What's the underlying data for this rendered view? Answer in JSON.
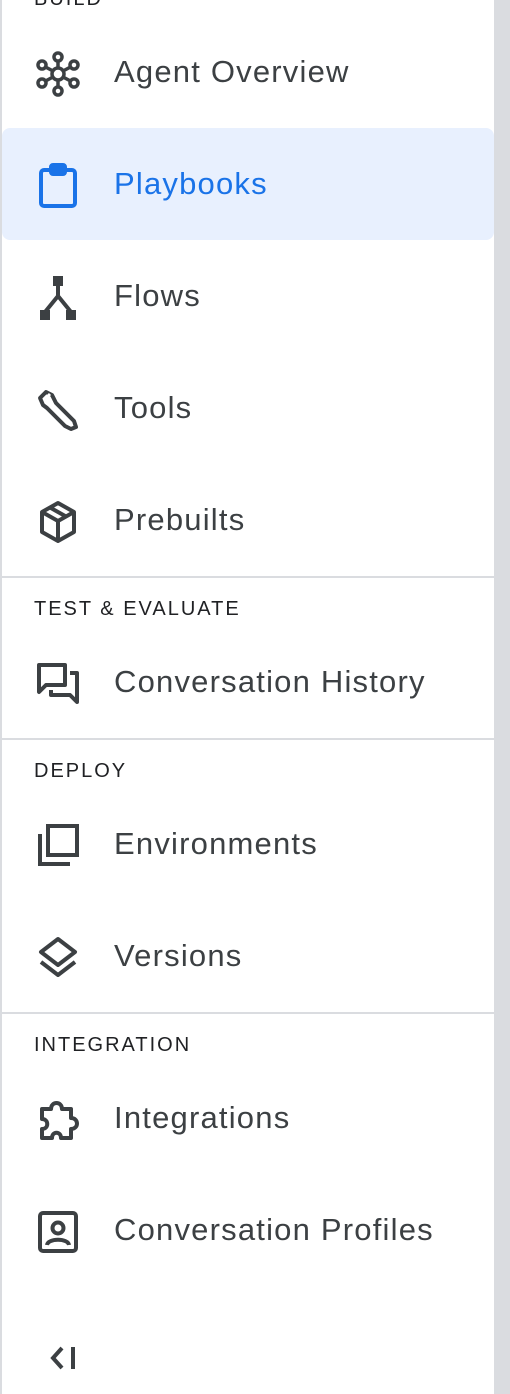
{
  "sections": {
    "build": {
      "title": "BUILD"
    },
    "test": {
      "title": "TEST & EVALUATE"
    },
    "deploy": {
      "title": "DEPLOY"
    },
    "integration": {
      "title": "INTEGRATION"
    }
  },
  "items": {
    "agent_overview": {
      "label": "Agent Overview",
      "icon": "hub-icon"
    },
    "playbooks": {
      "label": "Playbooks",
      "icon": "clipboard-icon",
      "active": true
    },
    "flows": {
      "label": "Flows",
      "icon": "flow-icon"
    },
    "tools": {
      "label": "Tools",
      "icon": "wrench-icon"
    },
    "prebuilts": {
      "label": "Prebuilts",
      "icon": "package-icon"
    },
    "conversation_history": {
      "label": "Conversation History",
      "icon": "chat-history-icon"
    },
    "environments": {
      "label": "Environments",
      "icon": "environment-icon"
    },
    "versions": {
      "label": "Versions",
      "icon": "layers-icon"
    },
    "integrations": {
      "label": "Integrations",
      "icon": "puzzle-icon"
    },
    "conversation_profiles": {
      "label": "Conversation Profiles",
      "icon": "profile-card-icon"
    }
  },
  "colors": {
    "active_bg": "#e8f0fe",
    "active_text": "#1a73e8",
    "text": "#3c4043",
    "icon": "#3c4043",
    "divider": "#dadce0"
  },
  "collapse": {
    "icon": "collapse-left-icon"
  }
}
